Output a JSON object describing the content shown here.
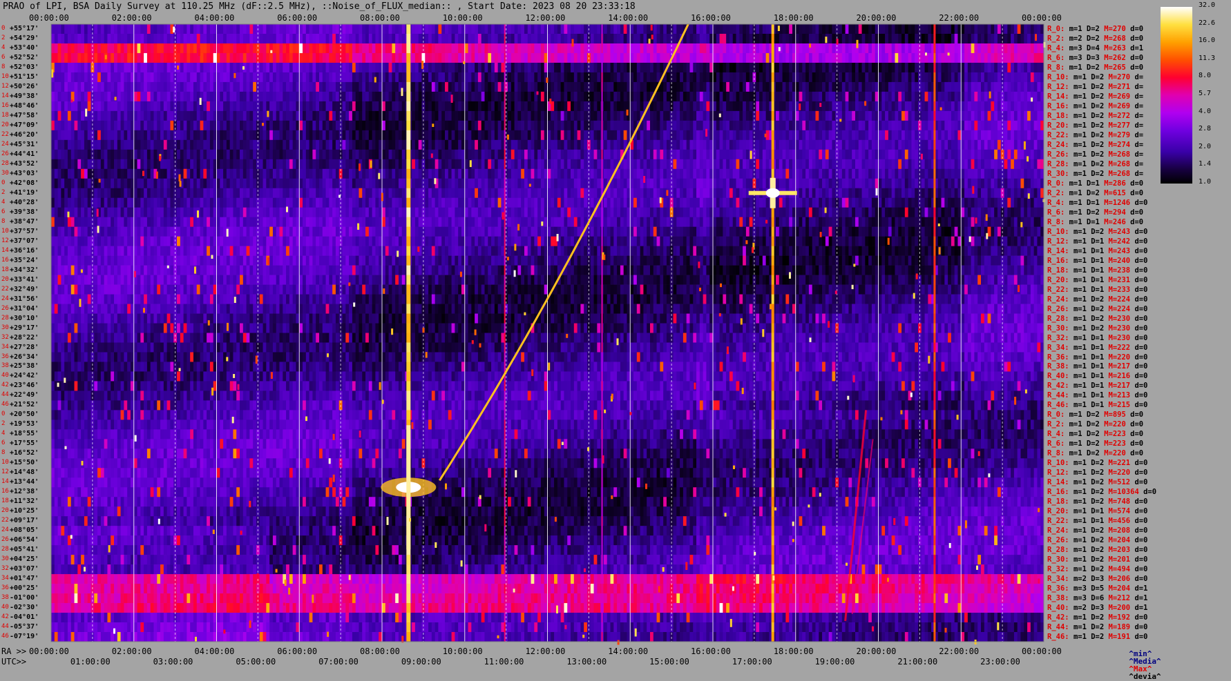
{
  "title": "PRAO of LPI, BSA Daily Survey at 110.25 MHz (dF::2.5 MHz), ::Noise_of_FLUX_median:: , Start Date: 2023 08 20 23:33:18",
  "ra_prefix": "RA >>",
  "utc_prefix": "UTC>>",
  "colors": {
    "background": "#a4a4a4",
    "red_label": "#e00000",
    "navy_label": "#000080"
  },
  "chart_data": {
    "type": "heatmap",
    "title": "PRAO of LPI, BSA Daily Survey at 110.25 MHz (dF::2.5 MHz), ::Noise_of_FLUX_median:: , Start Date: 2023 08 20 23:33:18",
    "x_top_ticks": [
      "00:00:00",
      "02:00:00",
      "04:00:00",
      "06:00:00",
      "08:00:00",
      "10:00:00",
      "12:00:00",
      "14:00:00",
      "16:00:00",
      "18:00:00",
      "20:00:00",
      "22:00:00",
      "00:00:00"
    ],
    "x_ra_ticks": [
      "00:00:00",
      "02:00:00",
      "04:00:00",
      "06:00:00",
      "08:00:00",
      "10:00:00",
      "12:00:00",
      "14:00:00",
      "16:00:00",
      "18:00:00",
      "20:00:00",
      "22:00:00",
      "00:00:00"
    ],
    "x_utc_ticks": [
      "01:00:00",
      "03:00:00",
      "05:00:00",
      "07:00:00",
      "09:00:00",
      "11:00:00",
      "13:00:00",
      "15:00:00",
      "17:00:00",
      "19:00:00",
      "21:00:00",
      "23:00:00"
    ],
    "y_declinations": [
      "+55°17'",
      "+54°29'",
      "+53°40'",
      "+52°52'",
      "+52°03'",
      "+51°15'",
      "+50°26'",
      "+49°38'",
      "+48°46'",
      "+47°58'",
      "+47°09'",
      "+46°20'",
      "+45°31'",
      "+44°41'",
      "+43°52'",
      "+43°03'",
      "+42°08'",
      "+41°19'",
      "+40°28'",
      "+39°38'",
      "+38°47'",
      "+37°57'",
      "+37°07'",
      "+36°16'",
      "+35°24'",
      "+34°32'",
      "+33°41'",
      "+32°49'",
      "+31°56'",
      "+31°04'",
      "+30°10'",
      "+29°17'",
      "+28°22'",
      "+27°28'",
      "+26°34'",
      "+25°38'",
      "+24°42'",
      "+23°46'",
      "+22°49'",
      "+21°52'",
      "+20°50'",
      "+19°53'",
      "+18°55'",
      "+17°55'",
      "+16°52'",
      "+15°50'",
      "+14°48'",
      "+13°44'",
      "+12°38'",
      "+11°32'",
      "+10°25'",
      "+09°17'",
      "+08°05'",
      "+06°54'",
      "+05°41'",
      "+04°25'",
      "+03°07'",
      "+01°47'",
      "+00°25'",
      "-01°00'",
      "-02°30'",
      "-04°01'",
      "-05°37'",
      "-07°19'"
    ],
    "y_index": [
      "0",
      "2",
      "4",
      "6",
      "8",
      "10",
      "12",
      "14",
      "16",
      "18",
      "20",
      "22",
      "24",
      "26",
      "28",
      "30",
      "0",
      "2",
      "4",
      "6",
      "8",
      "10",
      "12",
      "14",
      "16",
      "18",
      "20",
      "22",
      "24",
      "26",
      "28",
      "30",
      "32",
      "34",
      "36",
      "38",
      "40",
      "42",
      "44",
      "46",
      "0",
      "2",
      "4",
      "6",
      "8",
      "10",
      "12",
      "14",
      "16",
      "18",
      "20",
      "22",
      "24",
      "26",
      "28",
      "30",
      "32",
      "34",
      "36",
      "38",
      "40",
      "42",
      "44",
      "46"
    ],
    "colorbar": [
      "32.0",
      "22.6",
      "16.0",
      "11.3",
      "8.0",
      "5.7",
      "4.0",
      "2.8",
      "2.0",
      "1.4",
      "1.0"
    ],
    "stats": [
      [
        "R_0:",
        "1",
        "2",
        "270",
        "0"
      ],
      [
        "R_2:",
        "2",
        "2",
        "268",
        "0"
      ],
      [
        "R_4:",
        "3",
        "4",
        "263",
        "1"
      ],
      [
        "R_6:",
        "3",
        "3",
        "262",
        "0"
      ],
      [
        "R_8:",
        "1",
        "2",
        "265",
        "0"
      ],
      [
        "R_10:",
        "1",
        "2",
        "270",
        ""
      ],
      [
        "R_12:",
        "1",
        "2",
        "271",
        ""
      ],
      [
        "R_14:",
        "1",
        "2",
        "269",
        ""
      ],
      [
        "R_16:",
        "1",
        "2",
        "269",
        ""
      ],
      [
        "R_18:",
        "1",
        "2",
        "272",
        ""
      ],
      [
        "R_20:",
        "1",
        "2",
        "277",
        ""
      ],
      [
        "R_22:",
        "1",
        "2",
        "279",
        ""
      ],
      [
        "R_24:",
        "1",
        "2",
        "274",
        ""
      ],
      [
        "R_26:",
        "1",
        "2",
        "268",
        ""
      ],
      [
        "R_28:",
        "1",
        "2",
        "268",
        ""
      ],
      [
        "R_30:",
        "1",
        "2",
        "268",
        ""
      ],
      [
        "R_0:",
        "1",
        "1",
        "286",
        "0"
      ],
      [
        "R_2:",
        "1",
        "2",
        "615",
        "0"
      ],
      [
        "R_4:",
        "1",
        "1",
        "1246",
        "0"
      ],
      [
        "R_6:",
        "1",
        "2",
        "294",
        "0"
      ],
      [
        "R_8:",
        "1",
        "1",
        "246",
        "0"
      ],
      [
        "R_10:",
        "1",
        "2",
        "243",
        "0"
      ],
      [
        "R_12:",
        "1",
        "1",
        "242",
        "0"
      ],
      [
        "R_14:",
        "1",
        "1",
        "243",
        "0"
      ],
      [
        "R_16:",
        "1",
        "1",
        "240",
        "0"
      ],
      [
        "R_18:",
        "1",
        "1",
        "238",
        "0"
      ],
      [
        "R_20:",
        "1",
        "1",
        "231",
        "0"
      ],
      [
        "R_22:",
        "1",
        "1",
        "233",
        "0"
      ],
      [
        "R_24:",
        "1",
        "2",
        "224",
        "0"
      ],
      [
        "R_26:",
        "1",
        "2",
        "224",
        "0"
      ],
      [
        "R_28:",
        "1",
        "2",
        "230",
        "0"
      ],
      [
        "R_30:",
        "1",
        "2",
        "230",
        "0"
      ],
      [
        "R_32:",
        "1",
        "1",
        "230",
        "0"
      ],
      [
        "R_34:",
        "1",
        "1",
        "222",
        "0"
      ],
      [
        "R_36:",
        "1",
        "1",
        "220",
        "0"
      ],
      [
        "R_38:",
        "1",
        "1",
        "217",
        "0"
      ],
      [
        "R_40:",
        "1",
        "1",
        "216",
        "0"
      ],
      [
        "R_42:",
        "1",
        "1",
        "217",
        "0"
      ],
      [
        "R_44:",
        "1",
        "1",
        "213",
        "0"
      ],
      [
        "R_46:",
        "1",
        "1",
        "215",
        "0"
      ],
      [
        "R_0:",
        "1",
        "2",
        "895",
        "0"
      ],
      [
        "R_2:",
        "1",
        "2",
        "220",
        "0"
      ],
      [
        "R_4:",
        "1",
        "2",
        "223",
        "0"
      ],
      [
        "R_6:",
        "1",
        "2",
        "223",
        "0"
      ],
      [
        "R_8:",
        "1",
        "2",
        "220",
        "0"
      ],
      [
        "R_10:",
        "1",
        "2",
        "221",
        "0"
      ],
      [
        "R_12:",
        "1",
        "2",
        "220",
        "0"
      ],
      [
        "R_14:",
        "1",
        "2",
        "512",
        "0"
      ],
      [
        "R_16:",
        "1",
        "2",
        "10364",
        "0"
      ],
      [
        "R_18:",
        "1",
        "2",
        "748",
        "0"
      ],
      [
        "R_20:",
        "1",
        "1",
        "574",
        "0"
      ],
      [
        "R_22:",
        "1",
        "1",
        "456",
        "0"
      ],
      [
        "R_24:",
        "1",
        "2",
        "208",
        "0"
      ],
      [
        "R_26:",
        "1",
        "2",
        "204",
        "0"
      ],
      [
        "R_28:",
        "1",
        "2",
        "203",
        "0"
      ],
      [
        "R_30:",
        "1",
        "2",
        "201",
        "0"
      ],
      [
        "R_32:",
        "1",
        "2",
        "494",
        "0"
      ],
      [
        "R_34:",
        "2",
        "3",
        "206",
        "0"
      ],
      [
        "R_36:",
        "3",
        "5",
        "204",
        "1"
      ],
      [
        "R_38:",
        "3",
        "6",
        "212",
        "1"
      ],
      [
        "R_40:",
        "2",
        "3",
        "200",
        "1"
      ],
      [
        "R_42:",
        "1",
        "2",
        "192",
        "0"
      ],
      [
        "R_44:",
        "1",
        "2",
        "189",
        "0"
      ],
      [
        "R_46:",
        "1",
        "2",
        "191",
        "0"
      ]
    ],
    "legend": [
      "^min^",
      "^Media^",
      "^Max^",
      "^devia^"
    ],
    "stat_keys": {
      "m": "m=",
      "D": "D=",
      "M": "M=",
      "d": "d="
    }
  }
}
